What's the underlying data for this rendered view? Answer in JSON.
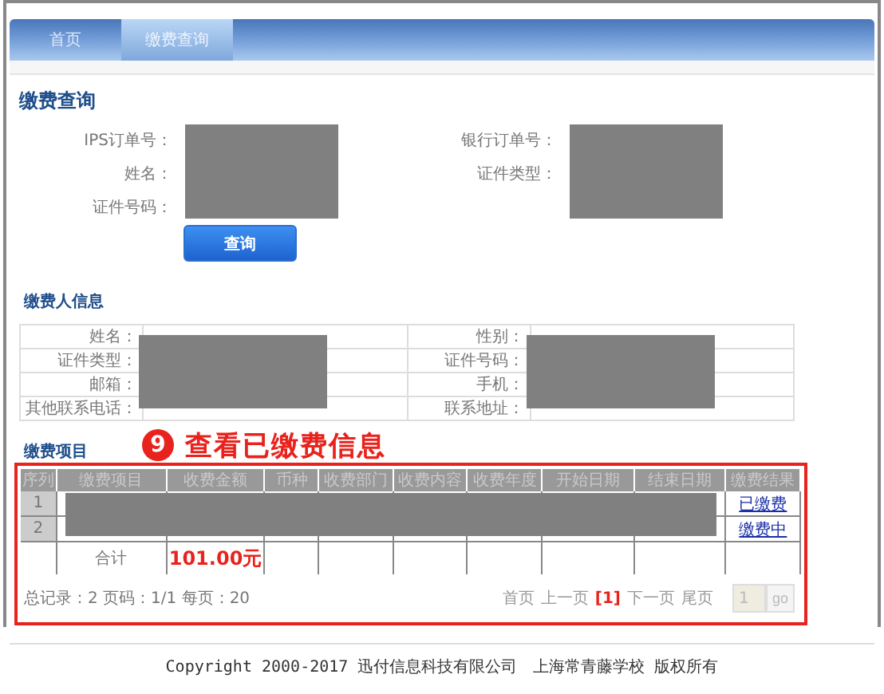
{
  "tabs": [
    {
      "label": "首页",
      "selected": false
    },
    {
      "label": "缴费查询",
      "selected": true
    }
  ],
  "query": {
    "title": "缴费查询",
    "left_fields": [
      "IPS订单号：",
      "姓名：",
      "证件号码："
    ],
    "right_fields": [
      "银行订单号：",
      "证件类型："
    ],
    "button": "查询"
  },
  "payer": {
    "title": "缴费人信息",
    "rows": [
      {
        "label_1": "姓名：",
        "label_2": "性别："
      },
      {
        "label_1": "证件类型：",
        "label_2": "证件号码："
      },
      {
        "label_1": "邮箱：",
        "label_2": "手机："
      },
      {
        "label_1": "其他联系电话：",
        "label_2": "联系地址："
      }
    ]
  },
  "items": {
    "title": "缴费项目",
    "annotation": {
      "number": "9",
      "text": "查看已缴费信息"
    },
    "columns": [
      "序列",
      "缴费项目",
      "收费金额",
      "币种",
      "收费部门",
      "收费内容",
      "收费年度",
      "开始日期",
      "结束日期",
      "缴费结果"
    ],
    "rows": [
      {
        "index": "1",
        "result": "已缴费"
      },
      {
        "index": "2",
        "result": "缴费中"
      }
    ],
    "total_label": "合计",
    "total_amount": "101.00元",
    "summary": "总记录：2 页码：1/1 每页：20",
    "pager": [
      {
        "label": "首页",
        "selected": false
      },
      {
        "label": "上一页",
        "selected": false
      },
      {
        "label": "[1]",
        "selected": true
      },
      {
        "label": "下一页",
        "selected": false
      },
      {
        "label": "尾页",
        "selected": false
      }
    ],
    "page_input": "1",
    "go_button": "go"
  },
  "footer": "Copyright 2000-2017 迅付信息科技有限公司　上海常青藤学校 版权所有"
}
